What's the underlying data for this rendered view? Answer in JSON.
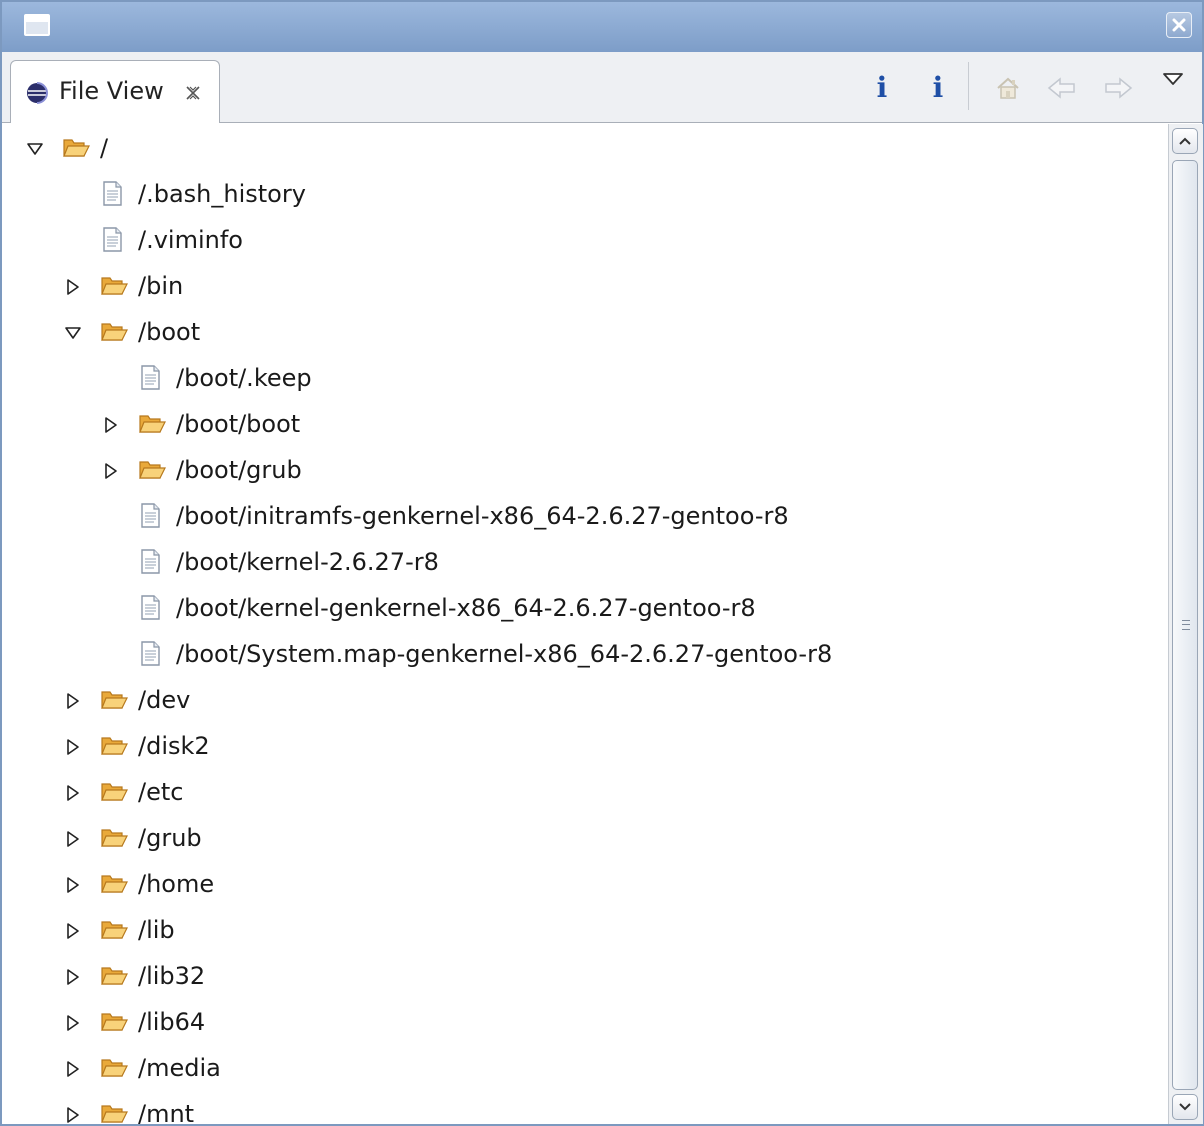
{
  "window": {
    "icon": "window-menu-icon",
    "close_icon": "close-icon"
  },
  "view": {
    "tab_title": "File View",
    "tab_icon": "eclipse-view-icon",
    "tab_close_icon": "tab-close-icon"
  },
  "toolbar": {
    "info_1": "i",
    "info_2": "i",
    "home_icon": "home-icon",
    "back_icon": "back-arrow-icon",
    "forward_icon": "forward-arrow-icon",
    "view_menu_icon": "view-menu-icon"
  },
  "colors": {
    "titlebar": "#8aa8d2",
    "folder": "#f3b84a",
    "info": "#1f4fa6"
  },
  "tree": [
    {
      "label": "/",
      "level": 0,
      "type": "folder",
      "state": "expanded"
    },
    {
      "label": "/.bash_history",
      "level": 1,
      "type": "file",
      "state": "leaf"
    },
    {
      "label": "/.viminfo",
      "level": 1,
      "type": "file",
      "state": "leaf"
    },
    {
      "label": "/bin",
      "level": 1,
      "type": "folder",
      "state": "collapsed"
    },
    {
      "label": "/boot",
      "level": 1,
      "type": "folder",
      "state": "expanded"
    },
    {
      "label": "/boot/.keep",
      "level": 2,
      "type": "file",
      "state": "leaf"
    },
    {
      "label": "/boot/boot",
      "level": 2,
      "type": "folder",
      "state": "collapsed"
    },
    {
      "label": "/boot/grub",
      "level": 2,
      "type": "folder",
      "state": "collapsed"
    },
    {
      "label": "/boot/initramfs-genkernel-x86_64-2.6.27-gentoo-r8",
      "level": 2,
      "type": "file",
      "state": "leaf"
    },
    {
      "label": "/boot/kernel-2.6.27-r8",
      "level": 2,
      "type": "file",
      "state": "leaf"
    },
    {
      "label": "/boot/kernel-genkernel-x86_64-2.6.27-gentoo-r8",
      "level": 2,
      "type": "file",
      "state": "leaf"
    },
    {
      "label": "/boot/System.map-genkernel-x86_64-2.6.27-gentoo-r8",
      "level": 2,
      "type": "file",
      "state": "leaf"
    },
    {
      "label": "/dev",
      "level": 1,
      "type": "folder",
      "state": "collapsed"
    },
    {
      "label": "/disk2",
      "level": 1,
      "type": "folder",
      "state": "collapsed"
    },
    {
      "label": "/etc",
      "level": 1,
      "type": "folder",
      "state": "collapsed"
    },
    {
      "label": "/grub",
      "level": 1,
      "type": "folder",
      "state": "collapsed"
    },
    {
      "label": "/home",
      "level": 1,
      "type": "folder",
      "state": "collapsed"
    },
    {
      "label": "/lib",
      "level": 1,
      "type": "folder",
      "state": "collapsed"
    },
    {
      "label": "/lib32",
      "level": 1,
      "type": "folder",
      "state": "collapsed"
    },
    {
      "label": "/lib64",
      "level": 1,
      "type": "folder",
      "state": "collapsed"
    },
    {
      "label": "/media",
      "level": 1,
      "type": "folder",
      "state": "collapsed"
    },
    {
      "label": "/mnt",
      "level": 1,
      "type": "folder",
      "state": "collapsed"
    }
  ],
  "scrollbar": {
    "up_icon": "scroll-up-icon",
    "down_icon": "scroll-down-icon",
    "thumb_fraction": 0.94
  }
}
